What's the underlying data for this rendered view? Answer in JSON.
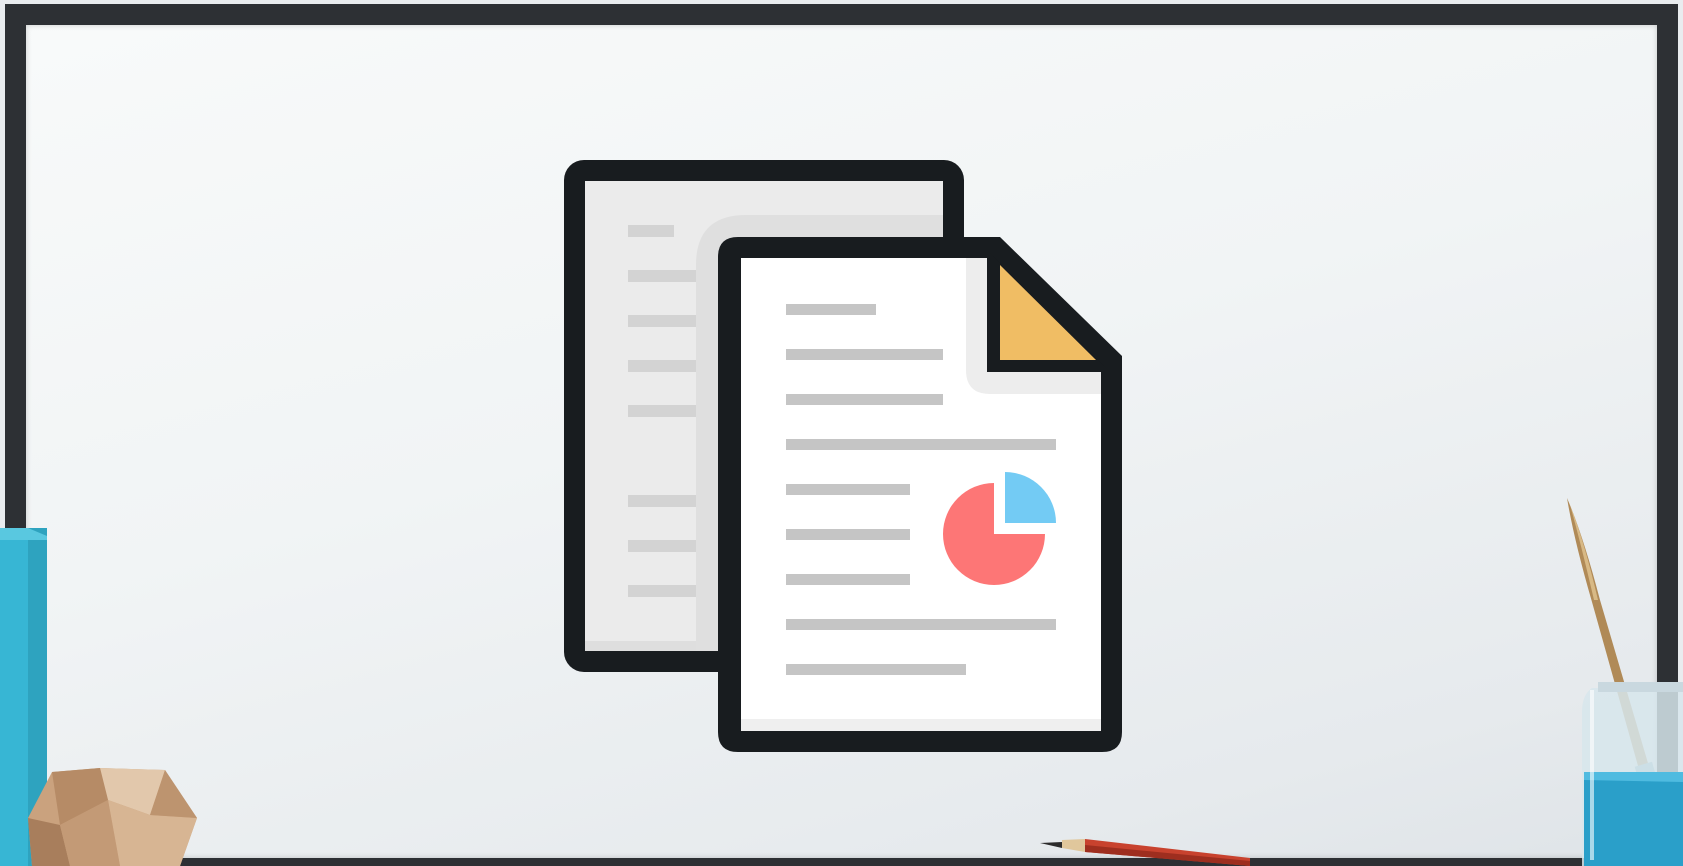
{
  "scene": {
    "icon": "documents-icon",
    "colors": {
      "frame": "#2d3034",
      "outline": "#181c1f",
      "paper_back": "#ebebeb",
      "paper_front": "#ffffff",
      "text_lines": "#c5c5c5",
      "fold_corner": "#f0bd64",
      "pie_main": "#fd7676",
      "pie_slice": "#73cbf4",
      "blue_block": "#37b6d4",
      "jar_liquid": "#2a9fc9"
    },
    "decorations": [
      "blue-block",
      "wooden-polyhedron",
      "pencil",
      "paintbrush",
      "water-jar"
    ]
  }
}
